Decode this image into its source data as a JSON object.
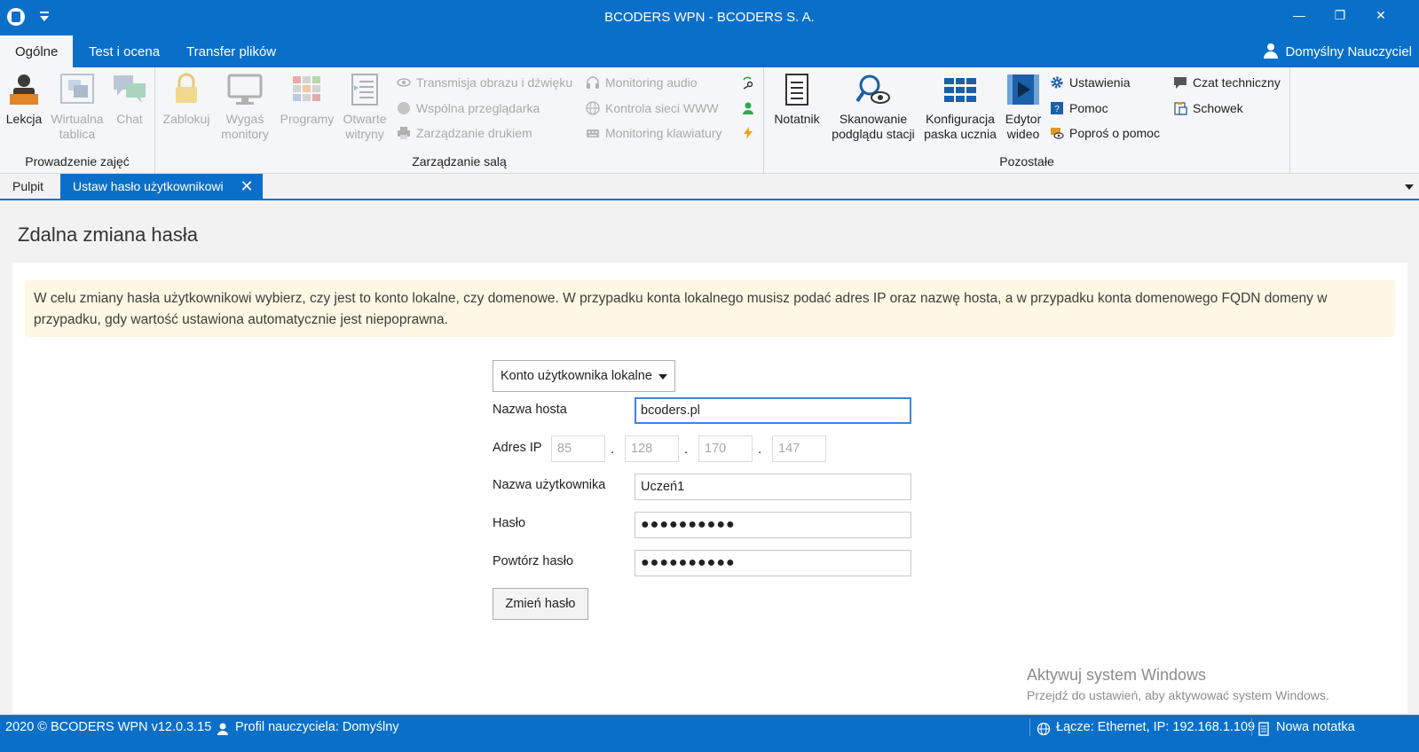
{
  "window": {
    "title": "BCODERS WPN - BCODERS S. A.",
    "minimize_glyph": "—",
    "restore_glyph": "❐",
    "close_glyph": "✕"
  },
  "ribbon_tabs": [
    {
      "label": "Ogólne",
      "active": true
    },
    {
      "label": "Test i ocena",
      "active": false
    },
    {
      "label": "Transfer plików",
      "active": false
    }
  ],
  "user_menu": {
    "label": "Domyślny Nauczyciel",
    "icon": "user-icon"
  },
  "ribbon": {
    "group1": {
      "label": "Prowadzenie zajęć",
      "buttons": [
        {
          "line1": "Lekcja",
          "line2": "",
          "icon": "teacher-icon",
          "enabled": true
        },
        {
          "line1": "Wirtualna",
          "line2": "tablica",
          "icon": "whiteboard-icon",
          "enabled": false
        },
        {
          "line1": "Chat",
          "line2": "",
          "icon": "chat-icon",
          "enabled": false
        }
      ]
    },
    "group2": {
      "label": "Zarządzanie salą",
      "buttons": [
        {
          "line1": "Zablokuj",
          "line2": "",
          "icon": "lock-icon",
          "enabled": false
        },
        {
          "line1": "Wygaś",
          "line2": "monitory",
          "icon": "monitor-icon",
          "enabled": false
        },
        {
          "line1": "Programy",
          "line2": "",
          "icon": "programs-icon",
          "enabled": false
        },
        {
          "line1": "Otwarte",
          "line2": "witryny",
          "icon": "websites-icon",
          "enabled": false
        }
      ],
      "small_col1": [
        {
          "label": "Transmisja obrazu i dźwięku",
          "icon": "eye-icon",
          "enabled": false
        },
        {
          "label": "Wspólna przeglądarka",
          "icon": "globe-icon",
          "enabled": false
        },
        {
          "label": "Zarządzanie drukiem",
          "icon": "printer-icon",
          "enabled": false
        }
      ],
      "small_col2": [
        {
          "label": "Monitoring audio",
          "icon": "headphones-icon",
          "enabled": false
        },
        {
          "label": "Kontrola sieci WWW",
          "icon": "globe-icon",
          "enabled": false
        },
        {
          "label": "Monitoring klawiatury",
          "icon": "keyboard-icon",
          "enabled": false
        }
      ],
      "small_icons": [
        "refresh-key-icon",
        "user-green-icon",
        "lightning-icon"
      ]
    },
    "group3": {
      "label": "Pozostałe",
      "buttons": [
        {
          "line1": "Notatnik",
          "line2": "",
          "icon": "notepad-icon",
          "enabled": true
        },
        {
          "line1": "Skanowanie",
          "line2": "podglądu stacji",
          "icon": "scan-icon",
          "enabled": true
        },
        {
          "line1": "Konfiguracja",
          "line2": "paska ucznia",
          "icon": "toolbar-config-icon",
          "enabled": true
        },
        {
          "line1": "Edytor",
          "line2": "wideo",
          "icon": "video-editor-icon",
          "enabled": true
        }
      ],
      "small_col1": [
        {
          "label": "Ustawienia",
          "icon": "gear-icon",
          "enabled": true
        },
        {
          "label": "Pomoc",
          "icon": "help-icon",
          "enabled": true
        },
        {
          "label": "Poproś o pomoc",
          "icon": "ask-help-icon",
          "enabled": true
        }
      ],
      "small_col2": [
        {
          "label": "Czat techniczny",
          "icon": "tech-chat-icon",
          "enabled": true
        },
        {
          "label": "Schowek",
          "icon": "clipboard-icon",
          "enabled": true
        }
      ]
    }
  },
  "doc_tabs": [
    {
      "label": "Pulpit",
      "active": false
    },
    {
      "label": "Ustaw hasło użytkownikowi",
      "active": true,
      "close": "✕"
    }
  ],
  "page": {
    "title": "Zdalna zmiana hasła",
    "info": "W celu zmiany hasła użytkownikowi wybierz, czy jest to konto lokalne, czy domenowe. W przypadku konta lokalnego musisz podać adres IP oraz nazwę hosta, a w przypadku konta domenowego FQDN domeny w przypadku, gdy wartość ustawiona automatycznie jest niepoprawna.",
    "account_type": {
      "selected": "Konto użytkownika lokalne"
    },
    "hostname": {
      "label": "Nazwa hosta",
      "value": "bcoders.pl"
    },
    "ip": {
      "label": "Adres IP",
      "octets": [
        "85",
        "128",
        "170",
        "147"
      ],
      "dot": "."
    },
    "username": {
      "label": "Nazwa użytkownika",
      "value": "Uczeń1"
    },
    "password": {
      "label": "Hasło",
      "masked": "●●●●●●●●●●"
    },
    "password_repeat": {
      "label": "Powtórz hasło",
      "masked": "●●●●●●●●●●"
    },
    "submit_label": "Zmień hasło"
  },
  "watermark": {
    "line1": "Aktywuj system Windows",
    "line2": "Przejdź do ustawień, aby aktywować system Windows."
  },
  "status": {
    "copyright": "2020 ©  BCODERS WPN v12.0.3.15",
    "profile": "Profil nauczyciela: Domyślny",
    "connection": "Łącze: Ethernet, IP: 192.168.1.109",
    "new_note": "Nowa notatka"
  },
  "colors": {
    "accent": "#0a6fc9",
    "info_bg": "#fcf8e3",
    "disabled": "#a9a9a9"
  }
}
